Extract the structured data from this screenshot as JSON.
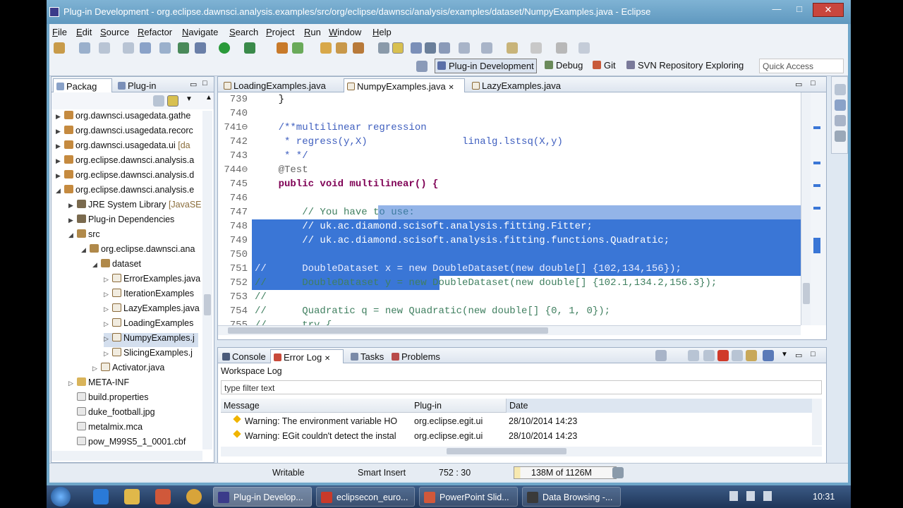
{
  "window": {
    "title": "Plug-in Development - org.eclipse.dawnsci.analysis.examples/src/org/eclipse/dawnsci/analysis/examples/dataset/NumpyExamples.java - Eclipse",
    "minimize": "—",
    "maximize": "□",
    "close": "✕"
  },
  "menu": [
    "File",
    "Edit",
    "Source",
    "Refactor",
    "Navigate",
    "Search",
    "Project",
    "Run",
    "Window",
    "Help"
  ],
  "perspectives": {
    "quick_access": "Quick Access",
    "items": [
      "Plug-in Development",
      "Debug",
      "Git",
      "SVN Repository Exploring"
    ]
  },
  "explorer": {
    "tabs": [
      "Packag",
      "Plug-in"
    ],
    "rows": [
      {
        "label": "org.dawnsci.usagedata.gathe",
        "deco": ""
      },
      {
        "label": "org.dawnsci.usagedata.recorc",
        "deco": ""
      },
      {
        "label": "org.dawnsci.usagedata.ui",
        "deco": "[da"
      },
      {
        "label": "org.eclipse.dawnsci.analysis.a",
        "deco": ""
      },
      {
        "label": "org.eclipse.dawnsci.analysis.d",
        "deco": ""
      },
      {
        "label": "org.eclipse.dawnsci.analysis.e",
        "deco": ""
      },
      {
        "label": "JRE System Library",
        "deco": "[JavaSE"
      },
      {
        "label": "Plug-in Dependencies",
        "deco": ""
      },
      {
        "label": "src",
        "deco": ""
      },
      {
        "label": "org.eclipse.dawnsci.ana",
        "deco": ""
      },
      {
        "label": "dataset",
        "deco": ""
      },
      {
        "label": "ErrorExamples.java",
        "deco": ""
      },
      {
        "label": "IterationExamples",
        "deco": ""
      },
      {
        "label": "LazyExamples.java",
        "deco": ""
      },
      {
        "label": "LoadingExamples",
        "deco": ""
      },
      {
        "label": "NumpyExamples.j",
        "deco": ""
      },
      {
        "label": "SlicingExamples.j",
        "deco": ""
      },
      {
        "label": "Activator.java",
        "deco": ""
      },
      {
        "label": "META-INF",
        "deco": ""
      },
      {
        "label": "build.properties",
        "deco": ""
      },
      {
        "label": "duke_football.jpg",
        "deco": ""
      },
      {
        "label": "metalmix.mca",
        "deco": ""
      },
      {
        "label": "pow_M99S5_1_0001.cbf",
        "deco": ""
      }
    ]
  },
  "editor": {
    "tabs": [
      "LoadingExamples.java",
      "NumpyExamples.java",
      "LazyExamples.java"
    ],
    "lines": [
      {
        "n": "739",
        "text": "    }"
      },
      {
        "n": "740",
        "text": ""
      },
      {
        "n": "741⊖",
        "text": "    /**multilinear regression"
      },
      {
        "n": "742",
        "text": "     * regress(y,X)                linalg.lstsq(X,y)"
      },
      {
        "n": "743",
        "text": "     * */"
      },
      {
        "n": "744⊖",
        "text": "    @Test"
      },
      {
        "n": "745",
        "text": "    public void multilinear() {"
      },
      {
        "n": "746",
        "text": ""
      },
      {
        "n": "747",
        "text": "        // You have to use:"
      },
      {
        "n": "748",
        "text": "        // uk.ac.diamond.scisoft.analysis.fitting.Fitter;"
      },
      {
        "n": "749",
        "text": "        // uk.ac.diamond.scisoft.analysis.fitting.functions.Quadratic;"
      },
      {
        "n": "750",
        "text": ""
      },
      {
        "n": "751",
        "text": "//      DoubleDataset x = new DoubleDataset(new double[] {102,134,156});"
      },
      {
        "n": "752",
        "text": "//      DoubleDataset y = new DoubleDataset(new double[] {102.1,134.2,156.3});"
      },
      {
        "n": "753",
        "text": "//"
      },
      {
        "n": "754",
        "text": "//      Quadratic q = new Quadratic(new double[] {0, 1, 0});"
      },
      {
        "n": "755",
        "text": "//      try {"
      }
    ]
  },
  "bottom": {
    "tabs": [
      "Console",
      "Error Log",
      "Tasks",
      "Problems"
    ],
    "workspace_log": "Workspace Log",
    "filter_placeholder": "type filter text",
    "columns": [
      "Message",
      "Plug-in",
      "Date"
    ],
    "rows": [
      {
        "message": "Warning: The environment variable HO",
        "plugin": "org.eclipse.egit.ui",
        "date": "28/10/2014 14:23"
      },
      {
        "message": "Warning: EGit couldn't detect the instal",
        "plugin": "org.eclipse.egit.ui",
        "date": "28/10/2014 14:23"
      }
    ]
  },
  "status": {
    "writable": "Writable",
    "insert_mode": "Smart Insert",
    "position": "752 : 30",
    "heap": "138M of 1126M"
  },
  "taskbar": {
    "tasks": [
      "Plug-in Develop...",
      "eclipsecon_euro...",
      "PowerPoint Slid...",
      "Data Browsing -..."
    ],
    "clock": "10:31"
  }
}
